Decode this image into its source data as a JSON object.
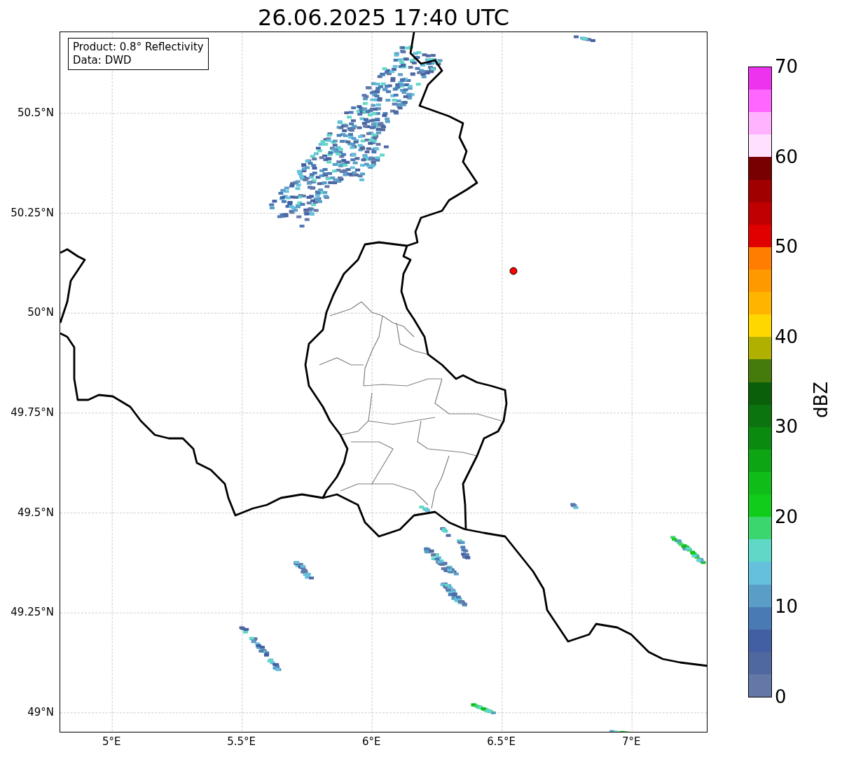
{
  "title": "26.06.2025 17:40 UTC",
  "info_box": {
    "lines": [
      "Product: 0.8° Reflectivity",
      "Data: DWD"
    ]
  },
  "map": {
    "lat_ticks": [
      "50.5°N",
      "50.25°N",
      "50°N",
      "49.75°N",
      "49.5°N",
      "49.25°N",
      "49°N"
    ],
    "lon_ticks": [
      "5°E",
      "5.5°E",
      "6°E",
      "6.5°E",
      "7°E"
    ]
  },
  "colorbar": {
    "label": "dBZ",
    "ticks": [
      "70",
      "60",
      "50",
      "40",
      "30",
      "20",
      "10",
      "0"
    ],
    "segments": [
      {
        "color": "#ee33ee"
      },
      {
        "color": "#ff66ff"
      },
      {
        "color": "#ffb3ff"
      },
      {
        "color": "#ffe0ff"
      },
      {
        "color": "#780000"
      },
      {
        "color": "#a00000"
      },
      {
        "color": "#c00000"
      },
      {
        "color": "#e00000"
      },
      {
        "color": "#ff7d00"
      },
      {
        "color": "#ff9900"
      },
      {
        "color": "#ffb400"
      },
      {
        "color": "#ffd700"
      },
      {
        "color": "#b0b000"
      },
      {
        "color": "#457a0c"
      },
      {
        "color": "#0a5f0a"
      },
      {
        "color": "#0b740f"
      },
      {
        "color": "#0b8a10"
      },
      {
        "color": "#0ea514"
      },
      {
        "color": "#10bd18"
      },
      {
        "color": "#12cc1c"
      },
      {
        "color": "#3cd66e"
      },
      {
        "color": "#60d8c8"
      },
      {
        "color": "#64c0dc"
      },
      {
        "color": "#5a9ec8"
      },
      {
        "color": "#4a7ab4"
      },
      {
        "color": "#425fa4"
      },
      {
        "color": "#5068a0"
      },
      {
        "color": "#6478a8"
      }
    ]
  }
}
